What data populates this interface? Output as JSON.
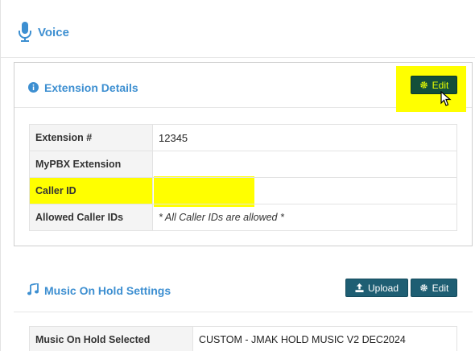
{
  "section": {
    "title": "Voice",
    "icon": "microphone-icon"
  },
  "extension_panel": {
    "title": "Extension Details",
    "icon": "info-circle-icon",
    "edit_label": "Edit",
    "rows": [
      {
        "label": "Extension #",
        "value": "12345"
      },
      {
        "label": "MyPBX Extension",
        "value": ""
      },
      {
        "label": "Caller ID",
        "value": ""
      },
      {
        "label": "Allowed Caller IDs",
        "value": "* All Caller IDs are allowed *"
      }
    ]
  },
  "moh_panel": {
    "title": "Music On Hold Settings",
    "icon": "music-note-icon",
    "upload_label": "Upload",
    "edit_label": "Edit",
    "rows": [
      {
        "label": "Music On Hold Selected",
        "value": "CUSTOM - JMAK HOLD MUSIC V2 DEC2024"
      }
    ]
  },
  "colors": {
    "accent": "#3d8fd1",
    "button": "#1e5e73",
    "highlight": "#ffff00"
  }
}
